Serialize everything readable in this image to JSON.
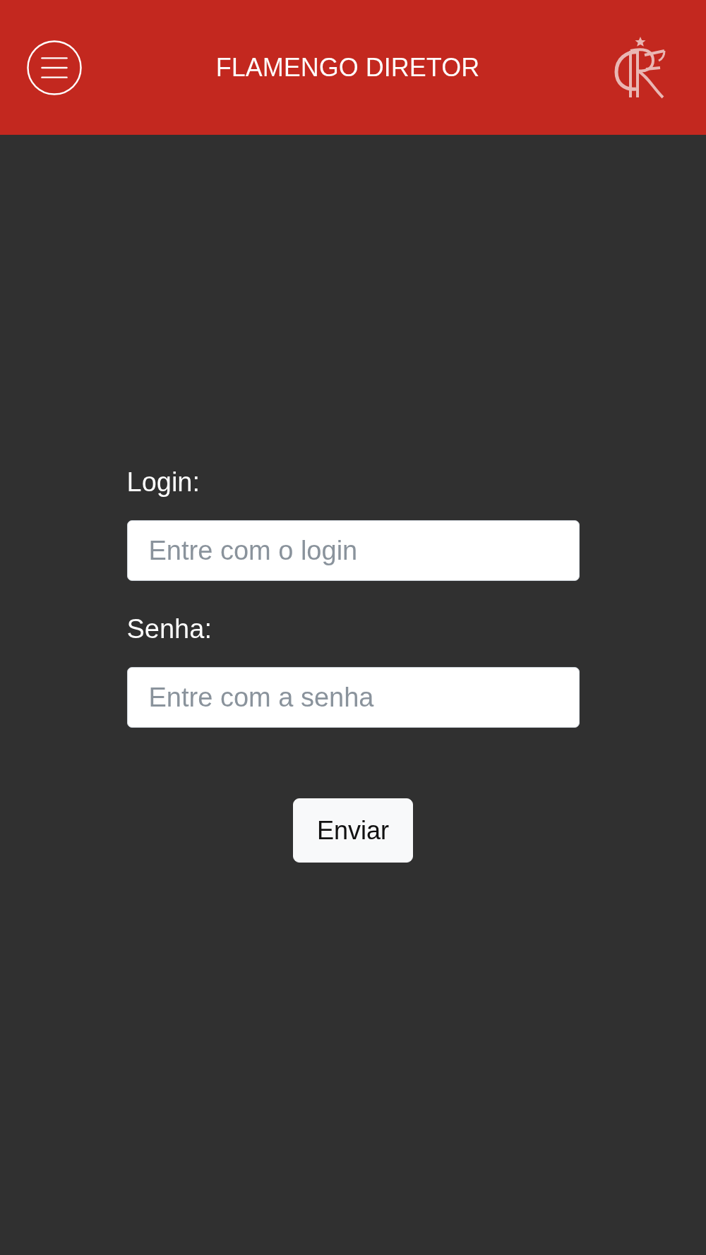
{
  "header": {
    "title": "FLAMENGO DIRETOR"
  },
  "form": {
    "fields": [
      {
        "label": "Login:",
        "placeholder": "Entre com o login"
      },
      {
        "label": "Senha:",
        "placeholder": "Entre com a senha"
      }
    ],
    "submit": {
      "label": "Enviar"
    }
  }
}
